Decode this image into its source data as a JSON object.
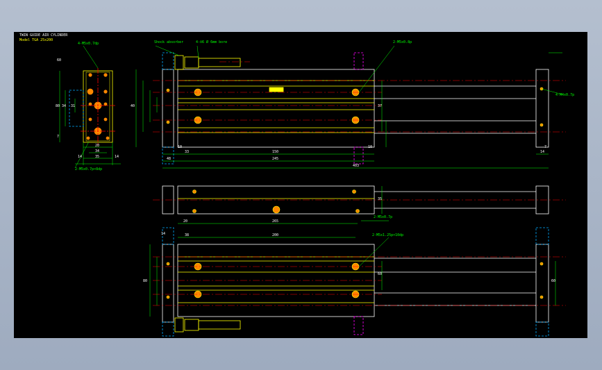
{
  "title_block": {
    "title": "TWIN GUIDE AIR CYLINDER",
    "model": "Model TGA 25x200"
  },
  "dimensions": {
    "side_view": [
      "20",
      "34",
      "35",
      "14",
      "14",
      "80",
      "34",
      "31",
      "60",
      "7"
    ],
    "top_view": [
      "48",
      "245",
      "403",
      "40",
      "150",
      "33",
      "10",
      "37",
      "10",
      "14",
      "7",
      "14",
      "14",
      "14"
    ],
    "middle_view": [
      "20",
      "265",
      "35",
      "14"
    ],
    "bottom_view": [
      "38",
      "200",
      "14",
      "80",
      "60",
      "60"
    ]
  },
  "callouts": [
    "4-M5x0.7dp",
    "4-ö6 Ø 6mm bore",
    "Shock absorber",
    "2-M5x0.8p",
    "4-M4x0.7p",
    "2-M5x0.7p×8dp",
    "2-M5x0.7p",
    "2-M5x1.25p×10dp"
  ],
  "colors": {
    "background": "#000000",
    "outline": "#ffffff",
    "part": "#ffff00",
    "dimension": "#00ff00",
    "centerline": "#ff0000",
    "hidden": "#00aaff",
    "hole": "#ff8800",
    "magenta": "#ff00ff"
  }
}
